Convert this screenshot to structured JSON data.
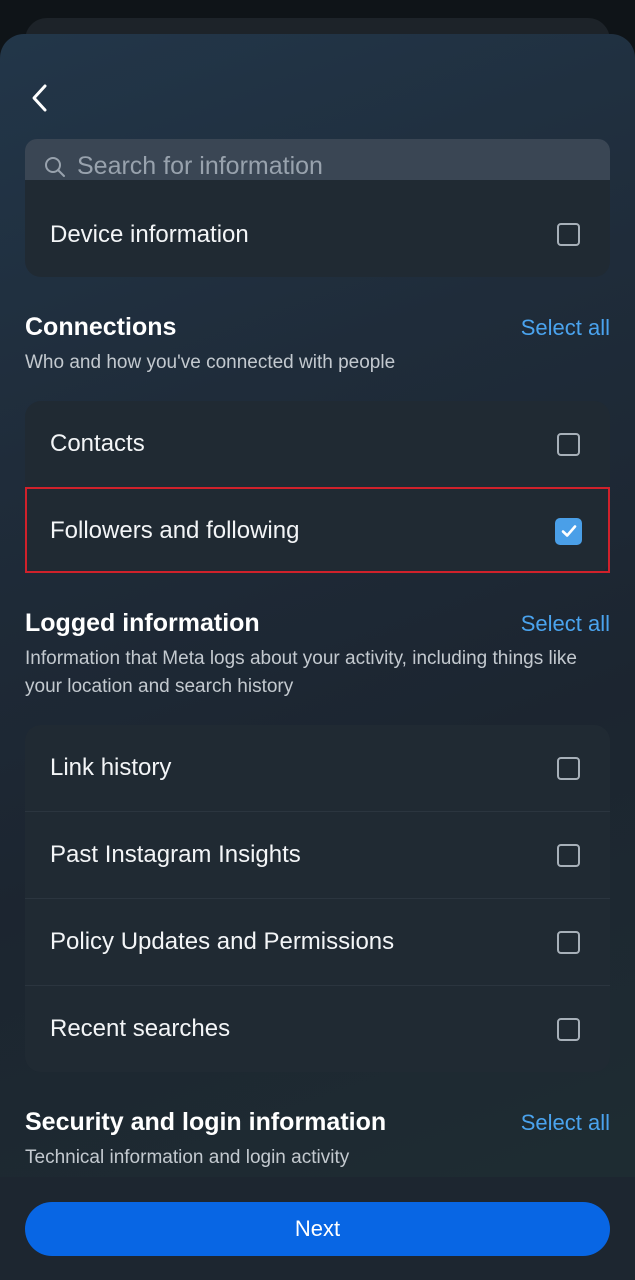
{
  "search": {
    "placeholder": "Search for information"
  },
  "top_card": {
    "rows": [
      {
        "label": "Device information",
        "checked": false
      }
    ]
  },
  "connections": {
    "title": "Connections",
    "select_all": "Select all",
    "description": "Who and how you've connected with people",
    "rows": [
      {
        "label": "Contacts",
        "checked": false
      },
      {
        "label": "Followers and following",
        "checked": true
      }
    ]
  },
  "logged": {
    "title": "Logged information",
    "select_all": "Select all",
    "description": "Information that Meta logs about your activity, including things like your location and search history",
    "rows": [
      {
        "label": "Link history",
        "checked": false
      },
      {
        "label": "Past Instagram Insights",
        "checked": false
      },
      {
        "label": "Policy Updates and Permissions",
        "checked": false
      },
      {
        "label": "Recent searches",
        "checked": false
      }
    ]
  },
  "security": {
    "title": "Security and login information",
    "select_all": "Select all",
    "description": "Technical information and login activity"
  },
  "footer": {
    "next_label": "Next"
  },
  "colors": {
    "accent": "#4a9fe8",
    "primary_button": "#0866e4",
    "highlight": "#d0212b"
  }
}
